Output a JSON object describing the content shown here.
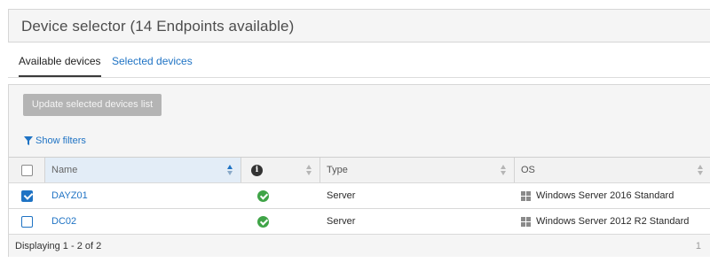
{
  "header": {
    "title": "Device selector (14 Endpoints available)"
  },
  "tabs": {
    "available": "Available devices",
    "selected": "Selected devices"
  },
  "toolbar": {
    "update_label": "Update selected devices list",
    "filters_label": "Show filters"
  },
  "table": {
    "columns": {
      "name": "Name",
      "info": "i",
      "type": "Type",
      "os": "OS"
    },
    "sorted_column": "Name",
    "sort_direction": "ascending",
    "rows": [
      {
        "name": "DAYZ01",
        "status": "ok",
        "type": "Server",
        "os": "Windows Server 2016 Standard",
        "checked": true
      },
      {
        "name": "DC02",
        "status": "ok",
        "type": "Server",
        "os": "Windows Server 2012 R2 Standard",
        "checked": false
      }
    ]
  },
  "footer": {
    "displaying": "Displaying 1 - 2 of 2",
    "page": "1"
  },
  "colors": {
    "accent": "#1f73c4",
    "ok": "#3fa447",
    "button_disabled": "#b4b4b4"
  },
  "icons": {
    "filter": "filter-funnel-icon",
    "info": "info-icon",
    "status": "check-circle-icon",
    "os": "windows-logo-icon"
  }
}
